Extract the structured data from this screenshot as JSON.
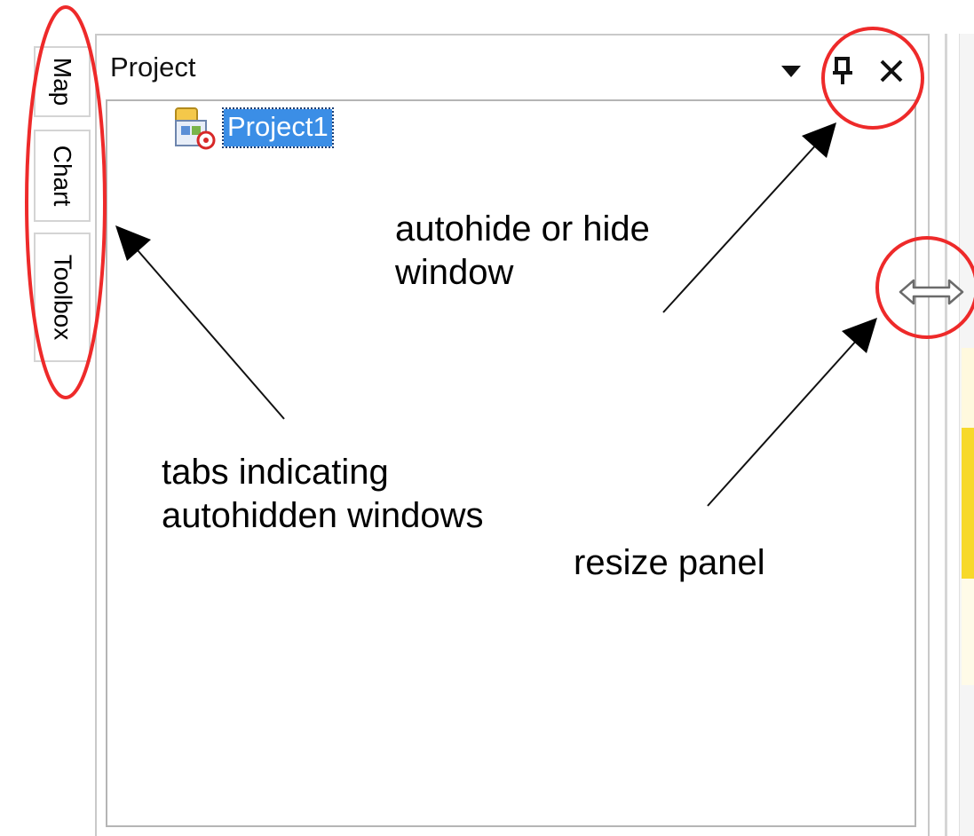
{
  "side_tabs": [
    {
      "label": "Map"
    },
    {
      "label": "Chart"
    },
    {
      "label": "Toolbox"
    }
  ],
  "panel": {
    "title": "Project",
    "dropdown_glyph": "▼",
    "pin_glyph": "📌",
    "close_glyph": "✕",
    "tree_item_label": "Project1"
  },
  "annotations": {
    "autohide": [
      "autohide or hide",
      "window"
    ],
    "tabs": [
      "tabs indicating",
      "autohidden windows"
    ],
    "resize": "resize panel"
  },
  "colors": {
    "highlight_circle": "#ee2a2a",
    "selection_bg": "#3b8ee6",
    "tab_border": "#d4d4d4"
  },
  "icons": {
    "project_icon": "project-folder-icon",
    "resize_icon": "resize-arrow-icon",
    "pin_icon": "pin-icon",
    "close_icon": "close-icon",
    "dropdown_icon": "dropdown-arrow-icon"
  }
}
